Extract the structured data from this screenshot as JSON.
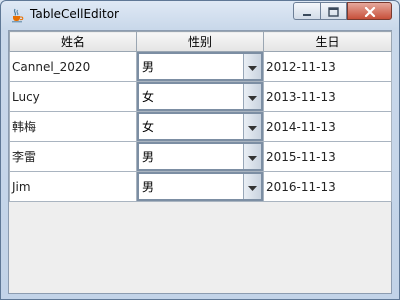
{
  "window": {
    "title": "TableCellEditor"
  },
  "table": {
    "columns": [
      "姓名",
      "性别",
      "生日"
    ],
    "rows": [
      {
        "name": "Cannel_2020",
        "gender": "男",
        "birthday": "2012-11-13"
      },
      {
        "name": "Lucy",
        "gender": "女",
        "birthday": "2013-11-13"
      },
      {
        "name": "韩梅",
        "gender": "女",
        "birthday": "2014-11-13"
      },
      {
        "name": "李雷",
        "gender": "男",
        "birthday": "2015-11-13"
      },
      {
        "name": "Jim",
        "gender": "男",
        "birthday": "2016-11-13"
      }
    ]
  },
  "icons": {
    "app": "java-coffee-cup-icon",
    "minimize": "minimize-icon",
    "maximize": "maximize-icon",
    "close": "close-icon",
    "dropdown": "chevron-down-icon"
  },
  "colors": {
    "title_bar": "#c9d8ea",
    "close_button": "#c7503a",
    "table_bg": "#ffffff",
    "empty_area": "#eeeeee"
  }
}
